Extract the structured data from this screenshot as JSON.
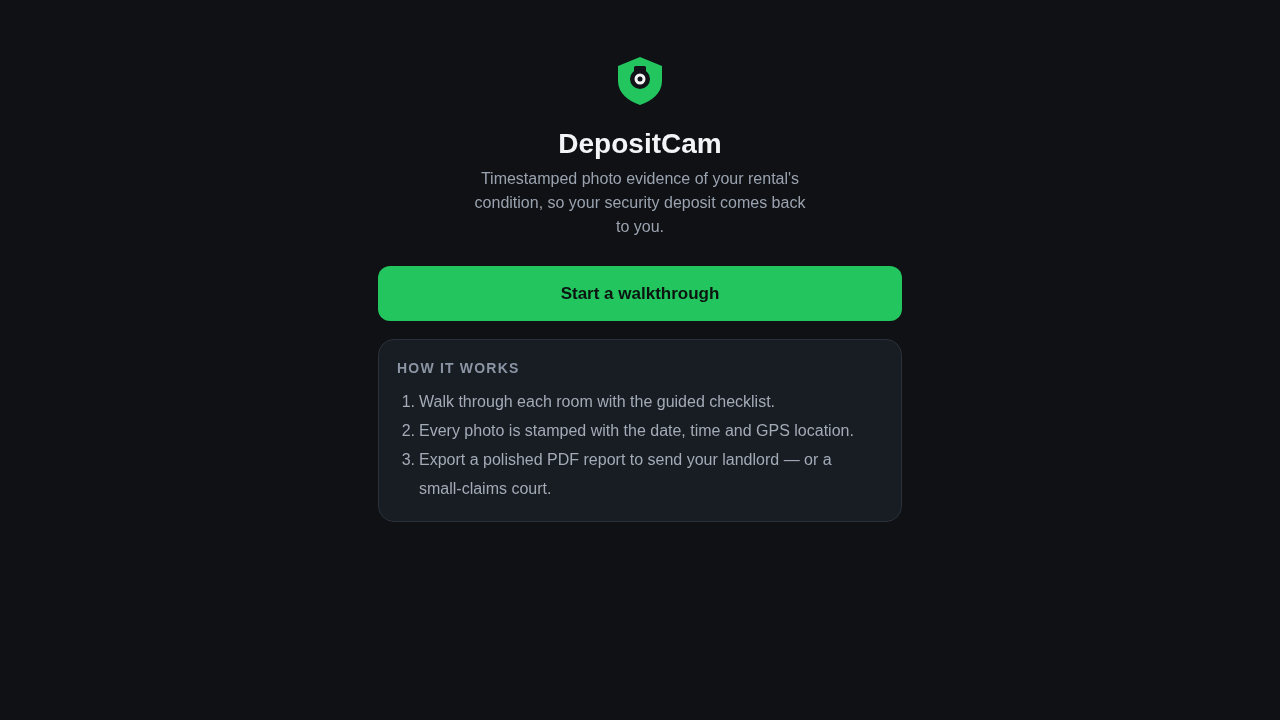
{
  "app": {
    "name": "DepositCam",
    "tagline": "Timestamped photo evidence of your rental's condition, so your security deposit comes back to you."
  },
  "primary_button": {
    "label": "Start a walkthrough"
  },
  "how_it_works": {
    "heading": "HOW IT WORKS",
    "steps": [
      {
        "number": "1.",
        "text": "Walk through each room with the guided checklist."
      },
      {
        "number": "2.",
        "text": "Every photo is stamped with the date, time and GPS location."
      },
      {
        "number": "3.",
        "text": "Export a polished PDF report to send your landlord — or a small-claims court."
      }
    ]
  }
}
